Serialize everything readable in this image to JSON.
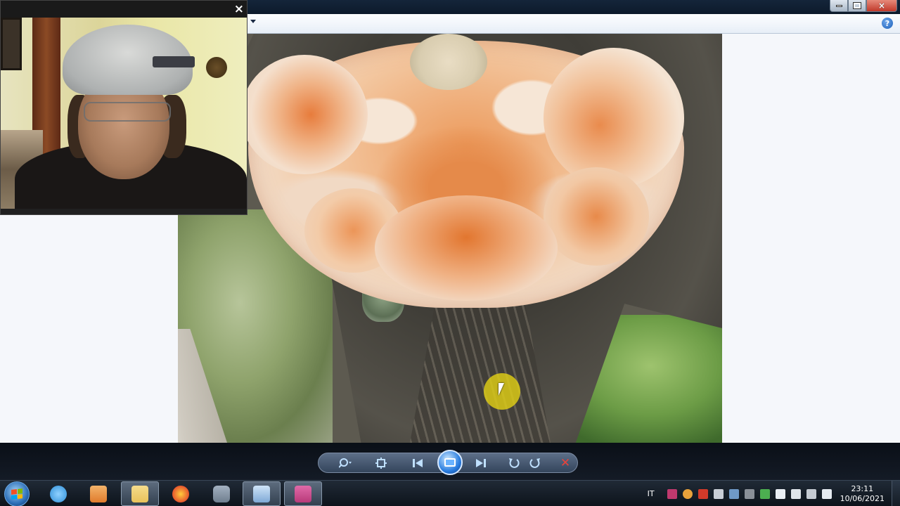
{
  "viewer": {
    "help_label": "?",
    "close_glyph": "×",
    "min_glyph": "",
    "max_glyph": ""
  },
  "webcam": {
    "close_label": "×"
  },
  "controls": {
    "zoom_icon": "magnifier-icon",
    "actual_size_icon": "actual-size-icon",
    "prev_icon": "previous-icon",
    "slideshow_icon": "slideshow-icon",
    "next_icon": "next-icon",
    "rotate_ccw_icon": "rotate-left-icon",
    "rotate_cw_icon": "rotate-right-icon",
    "delete_label": "✕"
  },
  "taskbar": {
    "apps": [
      {
        "name": "internet-explorer-icon",
        "color": "#2f8fd8"
      },
      {
        "name": "media-player-icon",
        "color": "#e07b2c"
      },
      {
        "name": "file-explorer-icon",
        "color": "#e9c25a"
      },
      {
        "name": "firefox-icon",
        "color": "#e6552d"
      },
      {
        "name": "webcam-app-icon",
        "color": "#6f7e8f"
      },
      {
        "name": "photo-viewer-icon",
        "color": "#7fa9d6"
      },
      {
        "name": "recorder-app-icon",
        "color": "#b83a7a"
      }
    ],
    "language": "IT",
    "time": "23:11",
    "date": "10/06/2021"
  },
  "colors": {
    "taskbar": "#0d131b",
    "viewer_bg": "#f5f7fb",
    "cursor_highlight": "#e4d214"
  }
}
